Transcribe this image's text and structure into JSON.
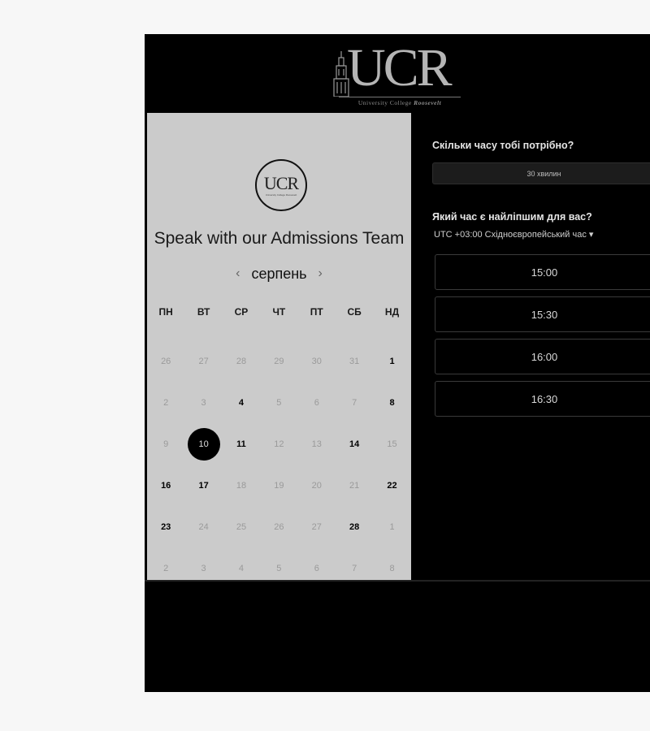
{
  "header": {
    "logo_letters": "UCR",
    "logo_subtitle_plain": "University College",
    "logo_subtitle_italic": "Roosevelt"
  },
  "left": {
    "small_logo_letters": "UCR",
    "small_logo_sub": "University College Roosevelt",
    "title": "Speak with our Admissions Team",
    "month": "серпень",
    "prev_icon": "‹",
    "next_icon": "›",
    "weekdays": [
      "ПН",
      "ВТ",
      "СР",
      "ЧТ",
      "ПТ",
      "СБ",
      "НД"
    ],
    "weeks": [
      [
        "26",
        "27",
        "28",
        "29",
        "30",
        "31",
        "1"
      ],
      [
        "2",
        "3",
        "4",
        "5",
        "6",
        "7",
        "8"
      ],
      [
        "9",
        "10",
        "11",
        "12",
        "13",
        "14",
        "15"
      ],
      [
        "16",
        "17",
        "18",
        "19",
        "20",
        "21",
        "22"
      ],
      [
        "23",
        "24",
        "25",
        "26",
        "27",
        "28",
        "1"
      ],
      [
        "2",
        "3",
        "4",
        "5",
        "6",
        "7",
        "8"
      ]
    ],
    "available_days": [
      "1",
      "4",
      "8",
      "11",
      "14",
      "16",
      "17",
      "22",
      "23",
      "28"
    ],
    "selected_day": "10"
  },
  "right": {
    "duration_question": "Скільки часу тобі потрібно?",
    "duration_value": "30 хвилин",
    "time_question": "Який час є найліпшим для вас?",
    "timezone": "UTC +03:00 Східноєвропейський час ▾",
    "slots": [
      "15:00",
      "15:30",
      "16:00",
      "16:30"
    ]
  },
  "colors": {
    "frame_bg": "#000000",
    "calendar_bg": "#cbcbcb",
    "selected_bg": "#000000"
  }
}
